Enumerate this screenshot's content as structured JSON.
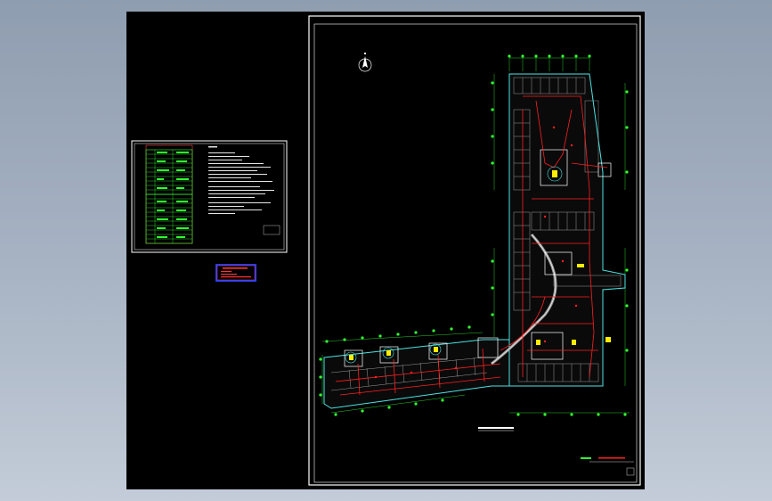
{
  "window": {
    "background_top": "#8f9db0",
    "background_bottom": "#c3ccd8",
    "canvas_color": "#000000"
  },
  "colors": {
    "wall": "#ffffff",
    "cyan_lines": "#4de3e3",
    "axis_green": "#33ff33",
    "pipe_red": "#ff2020",
    "equipment_yellow": "#ffee00",
    "stamp_blue": "#1f3fff"
  },
  "drawing": {
    "north_arrow": "north-arrow-symbol",
    "legend_sheet": "design-notes-and-legend",
    "stamp": "approval-stamp",
    "plan": "basement-floor-plan"
  }
}
